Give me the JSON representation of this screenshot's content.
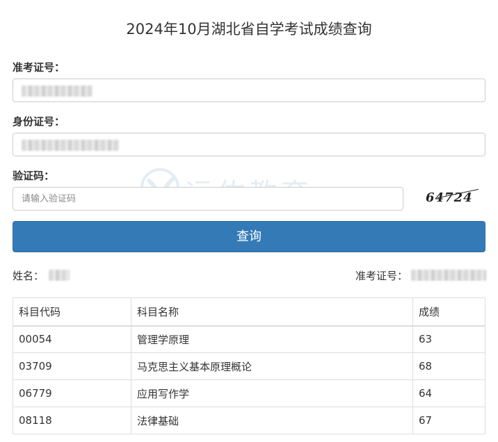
{
  "page": {
    "title": "2024年10月湖北省自学考试成绩查询"
  },
  "form": {
    "exam_no_label": "准考证号：",
    "id_no_label": "身份证号：",
    "captcha_label": "验证码：",
    "captcha_placeholder": "请输入验证码",
    "captcha_image_text": "64724",
    "submit_label": "查询"
  },
  "watermark": {
    "text": "远佑教育",
    "color": "#6a9fc6"
  },
  "result": {
    "name_label": "姓名：",
    "exam_no_label": "准考证号：",
    "columns": [
      "科目代码",
      "科目名称",
      "成绩"
    ],
    "rows": [
      {
        "code": "00054",
        "name": "管理学原理",
        "score": "63"
      },
      {
        "code": "03709",
        "name": "马克思主义基本原理概论",
        "score": "68"
      },
      {
        "code": "06779",
        "name": "应用写作学",
        "score": "64"
      },
      {
        "code": "08118",
        "name": "法律基础",
        "score": "67"
      }
    ]
  },
  "colors": {
    "primary_button": "#337ab7",
    "border": "#cccccc"
  }
}
